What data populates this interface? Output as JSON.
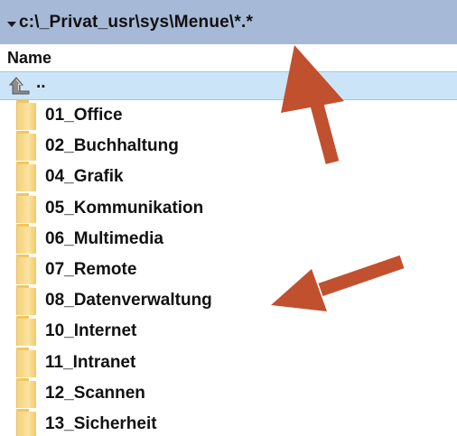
{
  "pathbar": {
    "path": "c:\\_Privat_usr\\sys\\Menue\\*.*",
    "icon": "chevron-down-icon"
  },
  "columns": {
    "name_header": "Name"
  },
  "parent_row": {
    "label": "..",
    "icon": "up-level-icon"
  },
  "folders": [
    {
      "name": "01_Office"
    },
    {
      "name": "02_Buchhaltung"
    },
    {
      "name": "04_Grafik"
    },
    {
      "name": "05_Kommunikation"
    },
    {
      "name": "06_Multimedia"
    },
    {
      "name": "07_Remote"
    },
    {
      "name": "08_Datenverwaltung"
    },
    {
      "name": "10_Internet"
    },
    {
      "name": "11_Intranet"
    },
    {
      "name": "12_Scannen"
    },
    {
      "name": "13_Sicherheit"
    }
  ],
  "colors": {
    "pathbar_bg": "#a6b9d6",
    "selection_bg": "#cce4f7",
    "arrow": "#c1502e",
    "folder": "#f6d27a"
  }
}
